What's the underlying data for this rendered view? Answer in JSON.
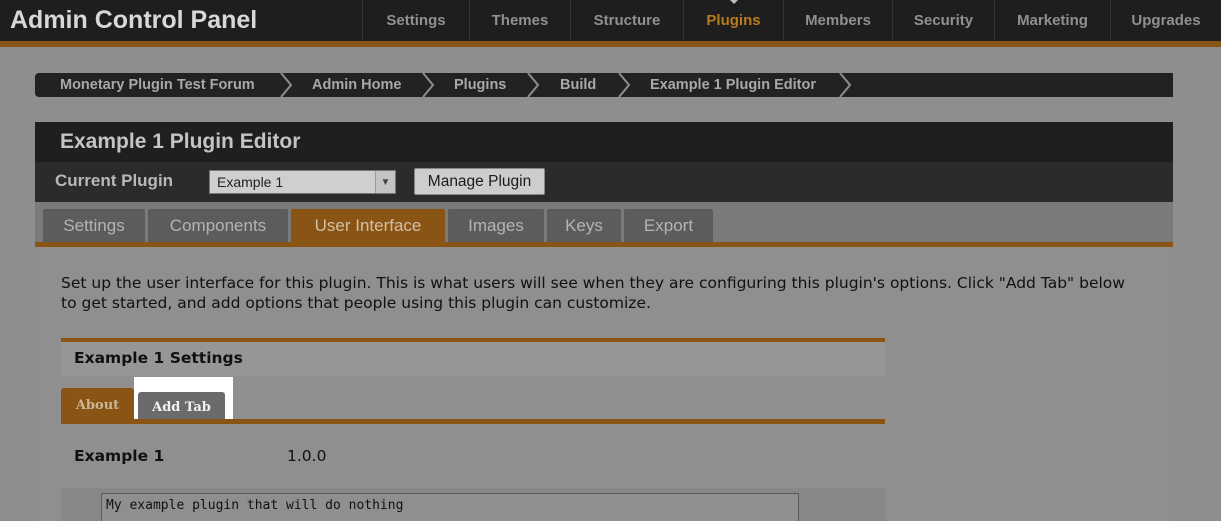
{
  "app": {
    "title": "Admin Control Panel"
  },
  "nav": {
    "items": [
      {
        "label": "Settings"
      },
      {
        "label": "Themes"
      },
      {
        "label": "Structure"
      },
      {
        "label": "Plugins"
      },
      {
        "label": "Members"
      },
      {
        "label": "Security"
      },
      {
        "label": "Marketing"
      },
      {
        "label": "Upgrades"
      }
    ],
    "active": "Plugins"
  },
  "breadcrumb": [
    {
      "label": "Monetary Plugin Test Forum"
    },
    {
      "label": "Admin Home"
    },
    {
      "label": "Plugins"
    },
    {
      "label": "Build"
    },
    {
      "label": "Example 1 Plugin Editor"
    }
  ],
  "panel": {
    "title": "Example 1 Plugin Editor",
    "current_plugin_label": "Current Plugin",
    "current_plugin_value": "Example 1",
    "manage_button": "Manage Plugin"
  },
  "tabs": [
    {
      "label": "Settings"
    },
    {
      "label": "Components"
    },
    {
      "label": "User Interface"
    },
    {
      "label": "Images"
    },
    {
      "label": "Keys"
    },
    {
      "label": "Export"
    }
  ],
  "active_tab": "User Interface",
  "content": {
    "intro": "Set up the user interface for this plugin. This is what users will see when they are configuring this plugin's options. Click \"Add Tab\" below to get started, and add options that people using this plugin can customize.",
    "settings_title": "Example 1 Settings",
    "subtabs": [
      {
        "label": "About"
      },
      {
        "label": "Add Tab"
      }
    ],
    "plugin_name": "Example 1",
    "plugin_version": "1.0.0",
    "description": "My example plugin that will do nothing"
  },
  "colors": {
    "accent": "#8a5414",
    "topbar": "#1e1e1e",
    "nav_active": "#b87a1a"
  }
}
